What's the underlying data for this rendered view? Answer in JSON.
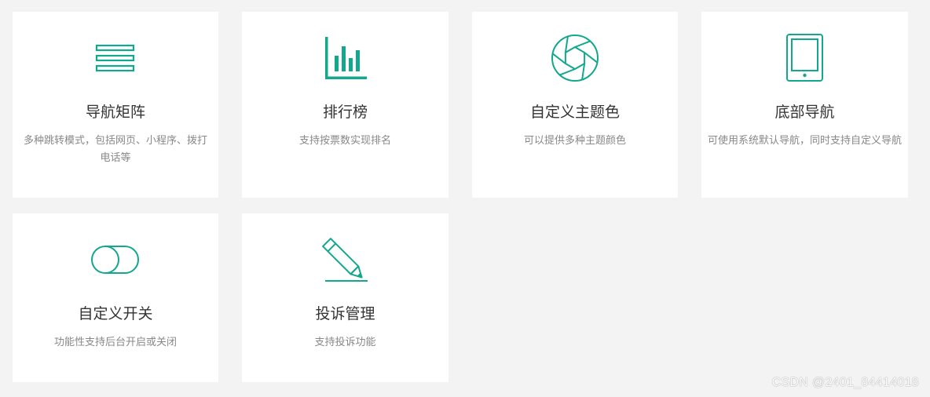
{
  "accent_color": "#12a88e",
  "cards": [
    {
      "icon": "list-icon",
      "title": "导航矩阵",
      "desc": "多种跳转模式，包括网页、小程序、拨打电话等"
    },
    {
      "icon": "bar-chart-icon",
      "title": "排行榜",
      "desc": "支持按票数实现排名"
    },
    {
      "icon": "aperture-icon",
      "title": "自定义主题色",
      "desc": "可以提供多种主题颜色"
    },
    {
      "icon": "tablet-icon",
      "title": "底部导航",
      "desc": "可使用系统默认导航，同时支持自定义导航"
    },
    {
      "icon": "toggle-icon",
      "title": "自定义开关",
      "desc": "功能性支持后台开启或关闭"
    },
    {
      "icon": "pencil-icon",
      "title": "投诉管理",
      "desc": "支持投诉功能"
    }
  ],
  "watermark": "CSDN @2401_84414018"
}
